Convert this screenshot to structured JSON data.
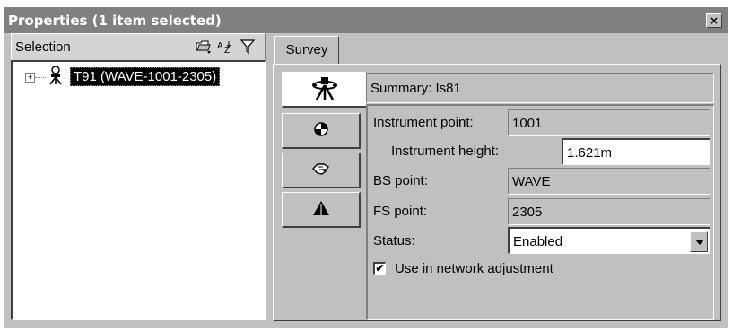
{
  "window": {
    "title": "Properties (1 item selected)",
    "close_label": "×"
  },
  "selection": {
    "header_label": "Selection",
    "icons": [
      "folder-dropdown-icon",
      "sort-az-icon",
      "filter-icon"
    ],
    "tree": [
      {
        "label": "T91 (WAVE-1001-2305)",
        "expand": "+",
        "selected": true
      }
    ]
  },
  "tabs": [
    {
      "label": "Survey",
      "active": true
    }
  ],
  "side_buttons": [
    "instrument-setup-icon",
    "target-icon",
    "hand-icon",
    "triangle-icon"
  ],
  "survey": {
    "summary": "Summary: Is81",
    "instrument_point_label": "Instrument point:",
    "instrument_point_value": "1001",
    "instrument_height_label": "Instrument height:",
    "instrument_height_value": "1.621m",
    "bs_point_label": "BS point:",
    "bs_point_value": "WAVE",
    "fs_point_label": "FS point:",
    "fs_point_value": "2305",
    "status_label": "Status:",
    "status_value": "Enabled",
    "network_adjustment_label": "Use in network adjustment",
    "network_adjustment_checked": true,
    "check_mark": "✔"
  },
  "colors": {
    "titlebar": "#808080",
    "face": "#c0c0c0",
    "selection_bg": "#000000"
  }
}
